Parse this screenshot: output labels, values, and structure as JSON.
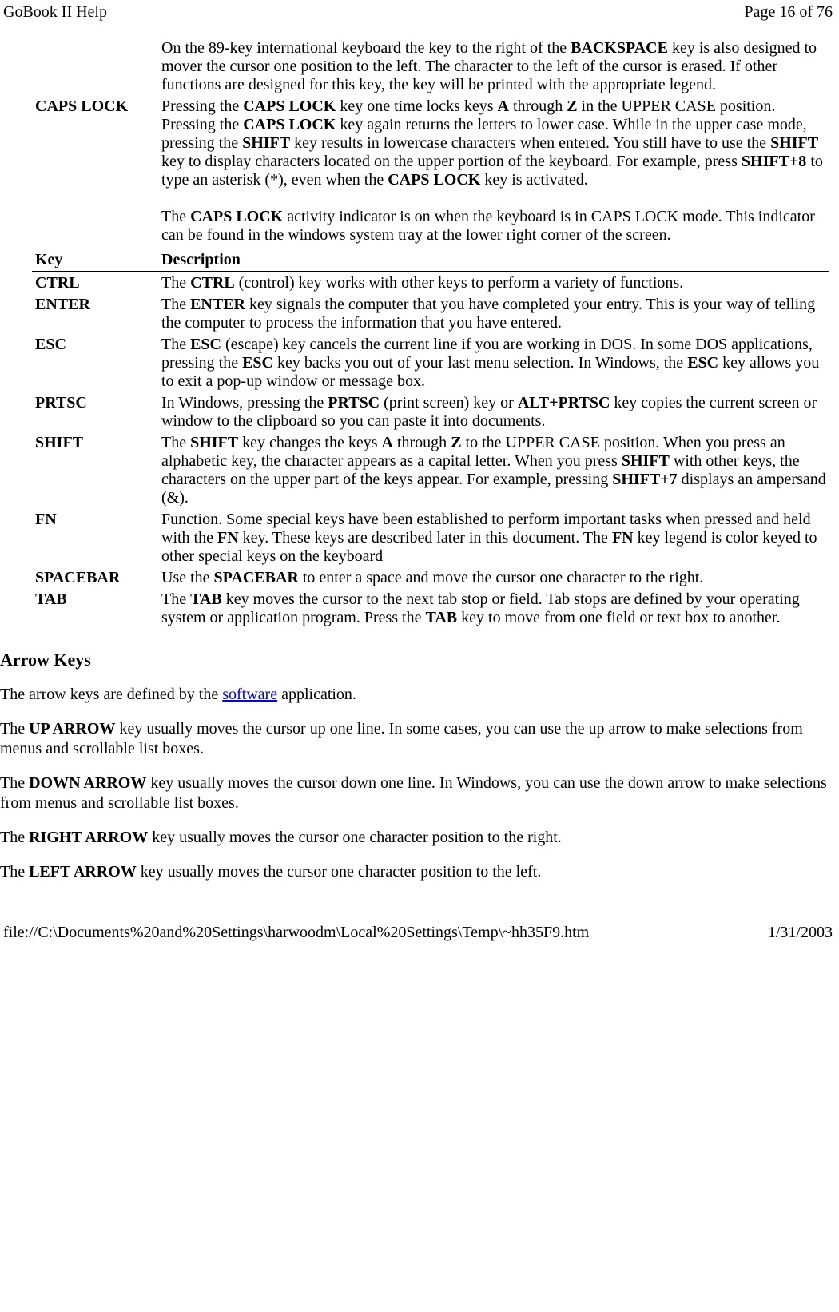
{
  "header": {
    "left": "GoBook II Help",
    "right": "Page 16 of 76"
  },
  "intro": {
    "backspace": {
      "p1a": "On the 89-key international keyboard the key to the right of the ",
      "p1b": "BACKSPACE",
      "p1c": " key is also designed to mover the cursor one position to the left.  The character to the left of the cursor is erased.  If other functions are designed for this key, the key will be printed with the appropriate legend."
    },
    "capslock": {
      "label": "CAPS LOCK",
      "d1a": "Pressing the ",
      "d1b": "CAPS LOCK",
      "d1c": " key one time locks keys ",
      "d1d": "A",
      "d1e": " through ",
      "d1f": "Z",
      "d1g": " in the UPPER CASE position. Pressing the ",
      "d1h": "CAPS LOCK",
      "d1i": " key again returns the letters to lower case. While in the upper case mode, pressing the ",
      "d1j": "SHIFT",
      "d1k": " key results in lowercase characters when entered. You still have to use the ",
      "d1l": "SHIFT",
      "d1m": " key to display characters located on the upper portion of the keyboard. For example, press ",
      "d1n": "SHIFT+8",
      "d1o": " to type an asterisk (*), even when the ",
      "d1p": "CAPS LOCK",
      "d1q": " key is activated.",
      "d2a": "The ",
      "d2b": "CAPS LOCK",
      "d2c": " activity indicator is on when the keyboard is in CAPS LOCK mode. This indicator can be found in the windows system tray at the lower right corner of the screen."
    }
  },
  "tableHeader": {
    "key": "Key",
    "desc": "Description"
  },
  "rows": {
    "ctrl": {
      "label": "CTRL",
      "a": "The ",
      "b": "CTRL",
      "c": " (control) key works with other keys to perform a variety of functions."
    },
    "enter": {
      "label": "ENTER",
      "a": "The ",
      "b": "ENTER",
      "c": " key signals the computer that you have completed your entry. This is your way of telling the computer to process the information that you have entered."
    },
    "esc": {
      "label": "ESC",
      "a": "The ",
      "b": "ESC",
      "c": " (escape) key cancels the current line if you are working in DOS. In some DOS applications, pressing the ",
      "d": "ESC",
      "e": " key backs you out of your last menu selection. In Windows, the ",
      "f": "ESC",
      "g": " key allows you to exit a pop-up window or message box."
    },
    "prtsc": {
      "label": "PRTSC",
      "a": "In Windows, pressing the ",
      "b": "PRTSC",
      "c": " (print screen) key or ",
      "d": "ALT+PRTSC",
      "e": " key copies the current screen or window to the clipboard so you can paste it into documents."
    },
    "shift": {
      "label": "SHIFT",
      "a": "The ",
      "b": "SHIFT",
      "c": " key changes the keys ",
      "d": "A",
      "e": " through ",
      "f": "Z",
      "g": " to the UPPER CASE position. When you press an alphabetic key, the character appears as a capital letter. When you press ",
      "h": "SHIFT",
      "i": " with other keys, the characters on the upper part of the keys appear. For example, pressing ",
      "j": "SHIFT+7",
      "k": " displays an ampersand (&)."
    },
    "fn": {
      "label": "FN",
      "a": "Function. Some special keys have been established to perform important tasks when pressed and held with the ",
      "b": "FN",
      "c": " key. These keys are described later in this document.  The ",
      "d": "FN",
      "e": " key legend is color keyed to other special keys on the keyboard"
    },
    "spacebar": {
      "label": "SPACEBAR",
      "a": "Use the ",
      "b": "SPACEBAR",
      "c": " to enter a space and move the cursor one character to the right."
    },
    "tab": {
      "label": "TAB",
      "a": "The ",
      "b": "TAB",
      "c": " key moves the cursor to the next tab stop or field. Tab stops are defined by your operating system or application program. Press the ",
      "d": "TAB",
      "e": " key to move from one field or text box to another."
    }
  },
  "arrow": {
    "heading": "Arrow Keys",
    "p1a": "The arrow keys are defined by the ",
    "p1link": "software",
    "p1b": " application.",
    "p2a": "The ",
    "p2b": "UP ARROW",
    "p2c": " key usually moves the cursor up one line. In some cases, you can use the up arrow to make selections from menus and scrollable list boxes.",
    "p3a": "The ",
    "p3b": "DOWN ARROW",
    "p3c": " key usually moves the cursor down one line. In Windows, you can use the down arrow to make selections from menus and scrollable list boxes.",
    "p4a": "The ",
    "p4b": "RIGHT ARROW",
    "p4c": " key usually moves the cursor one character position to the right.",
    "p5a": "The ",
    "p5b": "LEFT ARROW",
    "p5c": " key usually moves the cursor one character position to the left."
  },
  "footer": {
    "left": "file://C:\\Documents%20and%20Settings\\harwoodm\\Local%20Settings\\Temp\\~hh35F9.htm",
    "right": "1/31/2003"
  }
}
